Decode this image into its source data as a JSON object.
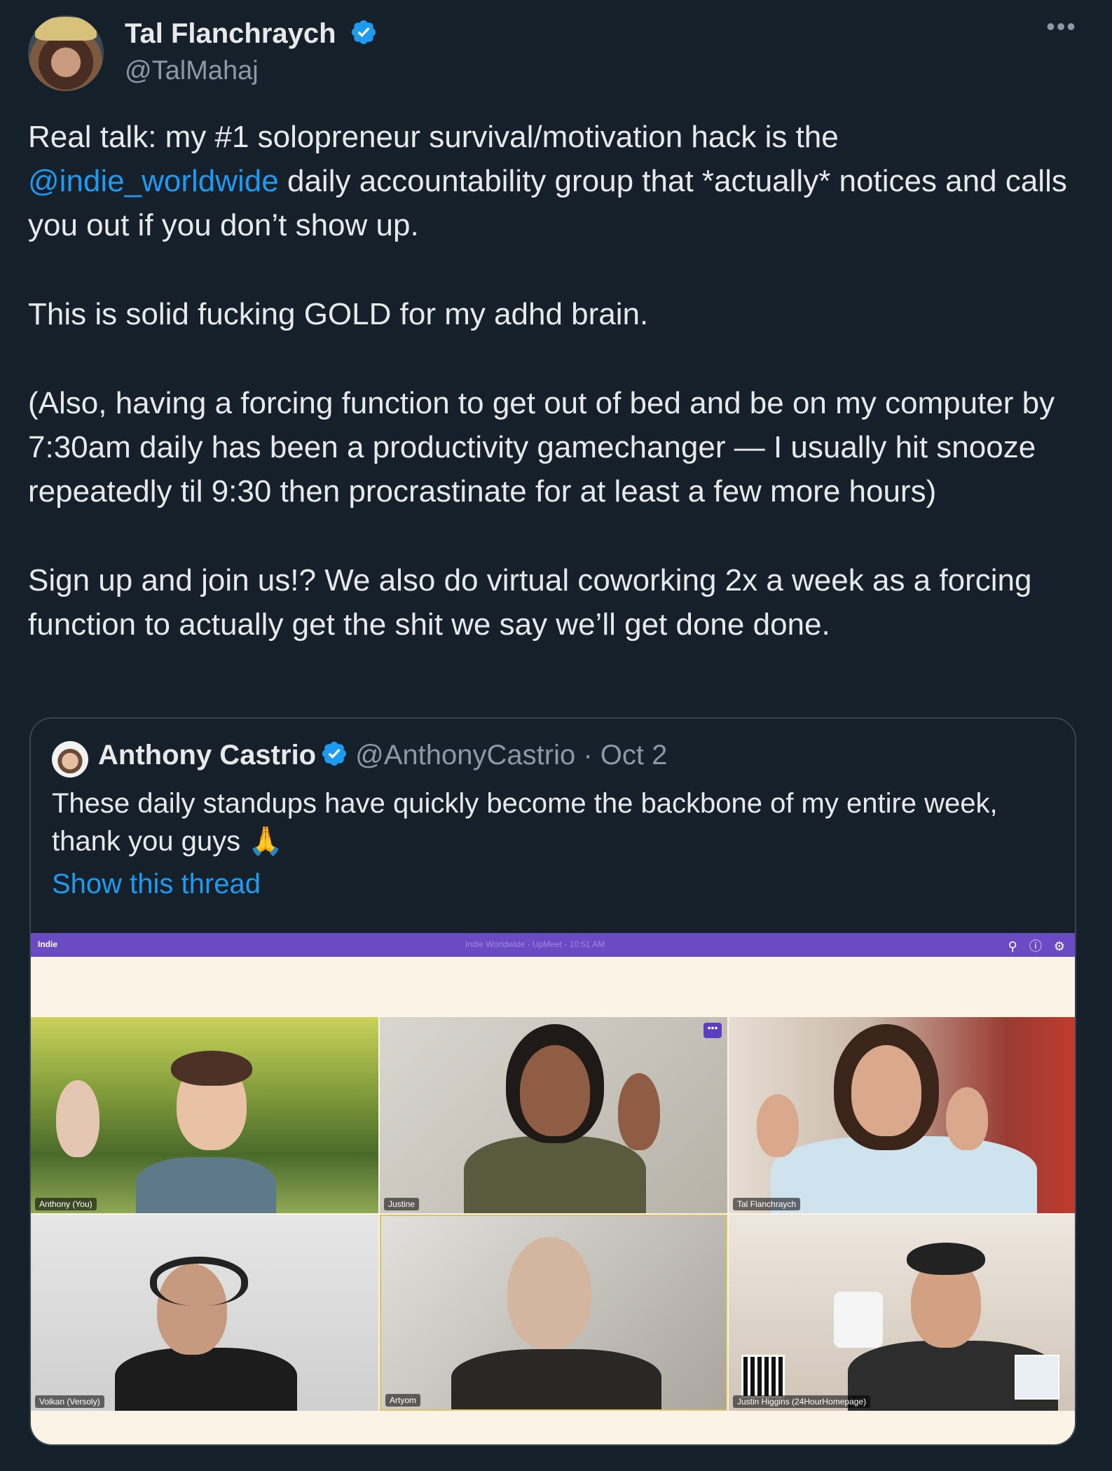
{
  "tweet": {
    "author_name": "Tal Flanchraych",
    "handle": "@TalMahaj",
    "more_icon": "more-horizontal-icon",
    "body": {
      "p1_prefix": "Real talk: my #1 solopreneur survival/motivation hack is the ",
      "p1_mention": "@indie_worldwide",
      "p1_suffix": " daily accountability group that *actually* notices and calls you out if you don’t show up.",
      "p2": "This is solid fucking GOLD for my adhd brain.",
      "p3": "(Also, having a forcing function to get out of bed and be on my computer by 7:30am daily has been a productivity gamechanger — I usually hit snooze repeatedly til 9:30 then procrastinate for at least a few more hours)",
      "p4": "Sign up and join us!? We also do virtual coworking 2x a week as a forcing function to actually get the shit we say we’ll get done done."
    }
  },
  "quote": {
    "author_name": "Anthony Castrio",
    "handle": "@AnthonyCastrio",
    "separator": "·",
    "date": "Oct 2",
    "text": "These daily standups have quickly become the backbone of my entire week, thank you guys 🙏",
    "show_thread": "Show this thread",
    "media": {
      "app_logo": "Indie",
      "window_title": "Indie Worldwide - UpMeet - 10:51 AM",
      "participants": [
        {
          "label": "Anthony (You)"
        },
        {
          "label": "Justine"
        },
        {
          "label": "Tal Flanchraych"
        },
        {
          "label": "Volkan (Versoly)"
        },
        {
          "label": "Artyom"
        },
        {
          "label": "Justin Higgins (24HourHomepage)"
        }
      ]
    }
  },
  "colors": {
    "background": "#15202b",
    "text": "#e7e9ea",
    "muted": "#8b98a5",
    "accent": "#1d9bf0",
    "meeting_bar": "#6a4bc4"
  }
}
